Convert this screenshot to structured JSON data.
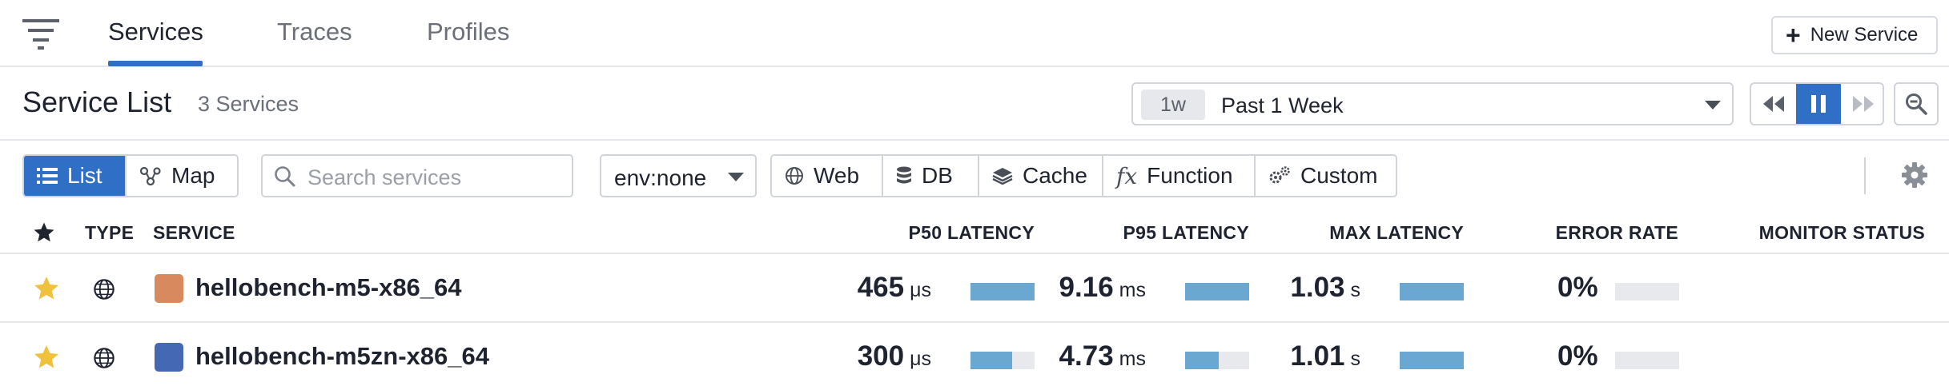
{
  "nav": {
    "tabs": [
      {
        "label": "Services",
        "active": true
      },
      {
        "label": "Traces",
        "active": false
      },
      {
        "label": "Profiles",
        "active": false
      }
    ],
    "new_service_label": "New Service"
  },
  "header": {
    "title": "Service List",
    "count": "3 Services",
    "timeframe": {
      "badge": "1w",
      "label": "Past 1 Week"
    }
  },
  "filters": {
    "view_list_label": "List",
    "view_map_label": "Map",
    "active_view": "List",
    "search_placeholder": "Search services",
    "env_value": "env:none",
    "types": [
      {
        "label": "Web",
        "icon": "globe-icon"
      },
      {
        "label": "DB",
        "icon": "database-icon"
      },
      {
        "label": "Cache",
        "icon": "layers-icon"
      },
      {
        "label": "Function",
        "icon": "function-icon"
      },
      {
        "label": "Custom",
        "icon": "gears-icon"
      }
    ]
  },
  "table": {
    "columns": {
      "type": "TYPE",
      "service": "SERVICE",
      "p50": "P50 LATENCY",
      "p95": "P95 LATENCY",
      "max": "MAX LATENCY",
      "error": "ERROR RATE",
      "monitor": "MONITOR STATUS"
    },
    "rows": [
      {
        "starred": true,
        "type_icon": "globe-icon",
        "color": "#d9895e",
        "name": "hellobench-m5-x86_64",
        "p50": {
          "value": "465",
          "unit": "μs",
          "level": 1.0
        },
        "p95": {
          "value": "9.16",
          "unit": "ms",
          "level": 1.0
        },
        "max": {
          "value": "1.03",
          "unit": "s",
          "level": 1.0
        },
        "error": {
          "value": "0%",
          "level": 0.0
        }
      },
      {
        "starred": true,
        "type_icon": "globe-icon",
        "color": "#4468b4",
        "name": "hellobench-m5zn-x86_64",
        "p50": {
          "value": "300",
          "unit": "μs",
          "level": 0.65
        },
        "p95": {
          "value": "4.73",
          "unit": "ms",
          "level": 0.52
        },
        "max": {
          "value": "1.01",
          "unit": "s",
          "level": 1.0
        },
        "error": {
          "value": "0%",
          "level": 0.0
        }
      }
    ]
  },
  "colors": {
    "accent": "#2f6fc6",
    "bar_fill": "#6aa7d1",
    "star": "#f0c23c"
  }
}
